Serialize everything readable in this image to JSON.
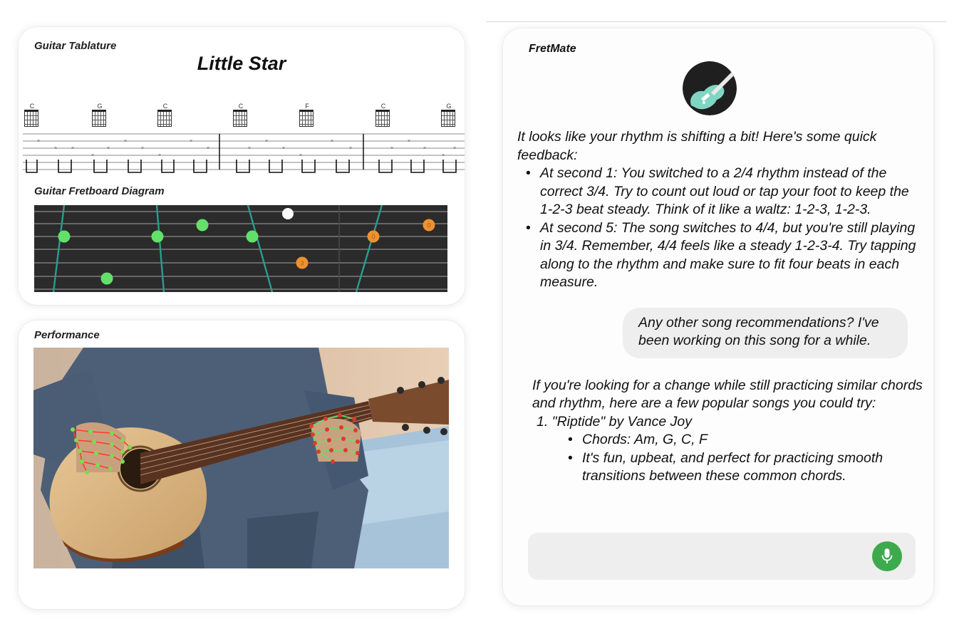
{
  "tablature_panel": {
    "label": "Guitar Tablature",
    "song_title": "Little Star",
    "chords": [
      "C",
      "G",
      "C",
      "C",
      "F",
      "C",
      "G"
    ]
  },
  "fretboard_panel": {
    "label": "Guitar Fretboard Diagram",
    "markers": [
      {
        "color": "green",
        "label": ""
      },
      {
        "color": "green",
        "label": ""
      },
      {
        "color": "green",
        "label": ""
      },
      {
        "color": "green",
        "label": ""
      },
      {
        "color": "green",
        "label": ""
      },
      {
        "color": "white",
        "label": ""
      },
      {
        "color": "orange",
        "label": "0"
      },
      {
        "color": "orange",
        "label": "0"
      },
      {
        "color": "orange",
        "label": "3"
      }
    ]
  },
  "performance_panel": {
    "label": "Performance"
  },
  "chat": {
    "app_name": "FretMate",
    "feedback_intro": "It looks like your rhythm is shifting a bit! Here's some quick feedback:",
    "feedback_items": [
      "At second 1: You switched to a 2/4 rhythm instead of the correct 3/4. Try to count out loud or tap your foot to keep the 1-2-3 beat steady. Think of it like a waltz: 1-2-3, 1-2-3.",
      "At second 5: The song switches to 4/4, but you're still playing in 3/4. Remember, 4/4 feels like a steady 1-2-3-4. Try tapping along to the rhythm and make sure to fit four beats in each measure."
    ],
    "user_message": "Any other song recommendations? I've been working on this song for a while.",
    "reply_intro": "If you're looking for a change while still practicing similar chords and rhythm, here are a few popular songs you could try:",
    "recommendations": [
      {
        "title": "1. \"Riptide\" by Vance Joy",
        "details": [
          "Chords: Am, G, C, F",
          "It's fun, upbeat, and perfect for practicing smooth transitions between these common chords."
        ]
      }
    ],
    "input_placeholder": ""
  },
  "colors": {
    "fretboard_bg": "#2b2b2b",
    "fret_line": "#2a9d8f",
    "green_marker": "#63e06a",
    "orange_marker": "#ee9130",
    "mic_button": "#3daa4e"
  },
  "icons": [
    "guitar-avatar-icon",
    "microphone-icon"
  ]
}
